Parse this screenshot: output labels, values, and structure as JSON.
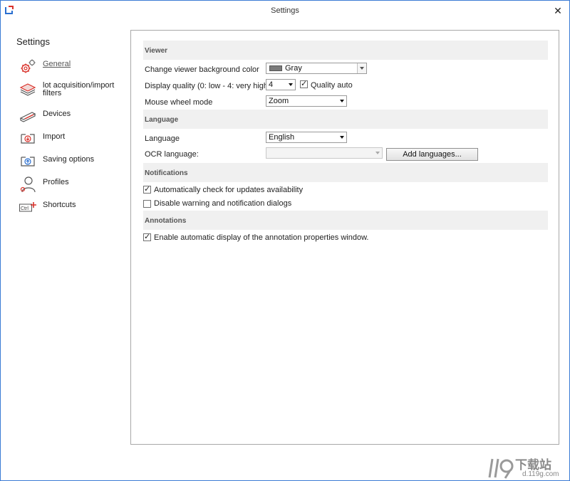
{
  "window": {
    "title": "Settings"
  },
  "sidebar": {
    "title": "Settings",
    "items": [
      {
        "label": "General",
        "icon": "gears-icon",
        "active": true
      },
      {
        "label": "lot acquisition/import filters",
        "icon": "stack-icon"
      },
      {
        "label": "Devices",
        "icon": "scanner-icon"
      },
      {
        "label": "Import",
        "icon": "import-icon"
      },
      {
        "label": "Saving options",
        "icon": "save-icon"
      },
      {
        "label": "Profiles",
        "icon": "profile-icon"
      },
      {
        "label": "Shortcuts",
        "icon": "ctrl-key-icon"
      }
    ]
  },
  "viewer": {
    "heading": "Viewer",
    "bg_color_label": "Change viewer background color",
    "bg_color_value": "Gray",
    "bg_color_swatch": "#7a7a7a",
    "quality_label": "Display quality (0: low - 4: very high)",
    "quality_value": "4",
    "quality_auto_label": "Quality auto",
    "quality_auto_checked": true,
    "wheel_label": "Mouse wheel mode",
    "wheel_value": "Zoom"
  },
  "language": {
    "heading": "Language",
    "language_label": "Language",
    "language_value": "English",
    "ocr_label": "OCR language:",
    "ocr_value": "",
    "add_button": "Add languages..."
  },
  "notifications": {
    "heading": "Notifications",
    "auto_check_label": "Automatically check for updates availability",
    "auto_check_checked": true,
    "disable_warn_label": "Disable warning and notification dialogs",
    "disable_warn_checked": false
  },
  "annotations": {
    "heading": "Annotations",
    "auto_display_label": "Enable automatic display of the annotation properties window.",
    "auto_display_checked": true
  },
  "watermark": {
    "text": "下载站",
    "url": "d.119g.com"
  }
}
